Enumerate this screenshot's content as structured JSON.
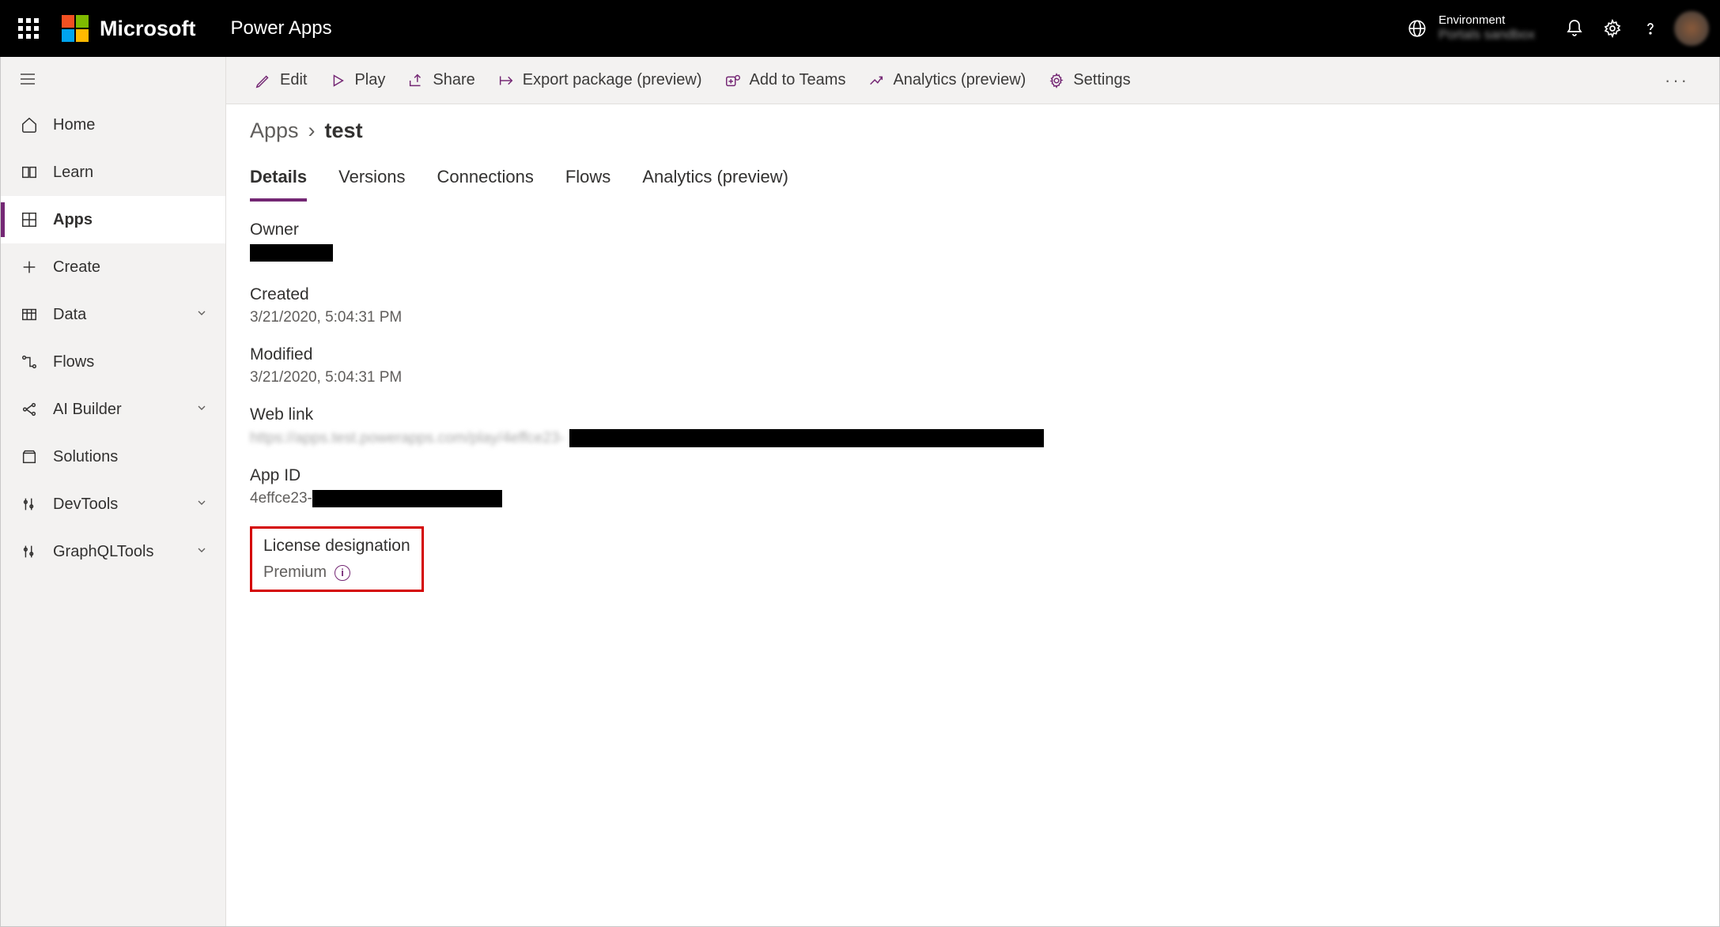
{
  "header": {
    "brand": "Microsoft",
    "app_name": "Power Apps",
    "environment_label": "Environment",
    "environment_name": "Portals sandbox"
  },
  "sidebar": {
    "items": [
      {
        "label": "Home"
      },
      {
        "label": "Learn"
      },
      {
        "label": "Apps"
      },
      {
        "label": "Create"
      },
      {
        "label": "Data"
      },
      {
        "label": "Flows"
      },
      {
        "label": "AI Builder"
      },
      {
        "label": "Solutions"
      },
      {
        "label": "DevTools"
      },
      {
        "label": "GraphQLTools"
      }
    ],
    "active": "Apps"
  },
  "commandbar": {
    "edit": "Edit",
    "play": "Play",
    "share": "Share",
    "export": "Export package (preview)",
    "teams": "Add to Teams",
    "analytics": "Analytics (preview)",
    "settings": "Settings"
  },
  "breadcrumb": {
    "root": "Apps",
    "leaf": "test"
  },
  "tabs": [
    "Details",
    "Versions",
    "Connections",
    "Flows",
    "Analytics (preview)"
  ],
  "active_tab": "Details",
  "details": {
    "owner_label": "Owner",
    "created_label": "Created",
    "created_value": "3/21/2020, 5:04:31 PM",
    "modified_label": "Modified",
    "modified_value": "3/21/2020, 5:04:31 PM",
    "weblink_label": "Web link",
    "weblink_blur": "https://apps.test.powerapps.com/play/4effce23-",
    "appid_label": "App ID",
    "appid_prefix": "4effce23-",
    "license_label": "License designation",
    "license_value": "Premium"
  }
}
